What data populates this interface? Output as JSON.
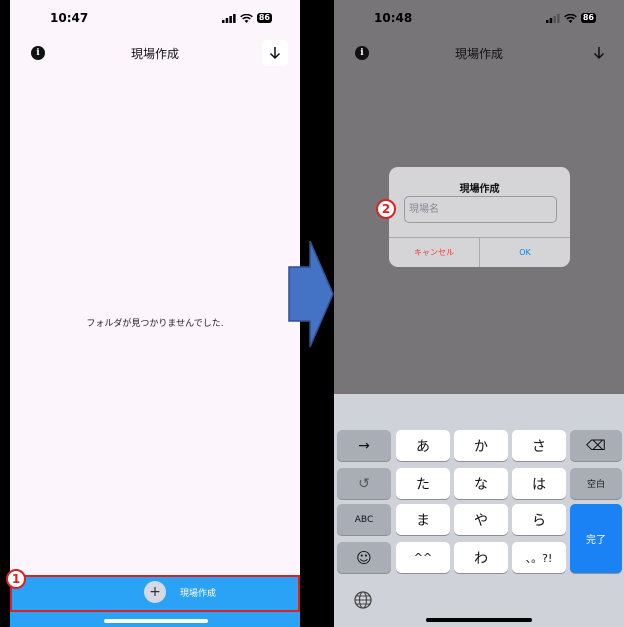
{
  "left_screen": {
    "status": {
      "time": "10:47",
      "battery": "86"
    },
    "nav": {
      "title": "現場作成"
    },
    "empty_message": "フォルダが見つかりませんでした.",
    "create_button": {
      "plus": "+",
      "label": "現場作成"
    },
    "annotation": "1"
  },
  "right_screen": {
    "status": {
      "time": "10:48",
      "battery": "86"
    },
    "nav": {
      "title": "現場作成"
    },
    "dialog": {
      "title": "現場作成",
      "input_placeholder": "現場名",
      "cancel_label": "キャンセル",
      "ok_label": "OK"
    },
    "annotation": "2",
    "keyboard": {
      "row1": [
        "→",
        "あ",
        "か",
        "さ",
        "⌫"
      ],
      "row2": [
        "↺",
        "た",
        "な",
        "は",
        "空白"
      ],
      "row3": [
        "ABC",
        "ま",
        "や",
        "ら"
      ],
      "row4": [
        "☺",
        "^^",
        "わ",
        "、。?!"
      ],
      "done_label": "完了",
      "globe": "globe-icon"
    }
  },
  "colors": {
    "accent_blue": "#2aa2f5",
    "callout_red": "#e02020",
    "arrow_blue": "#4472c4"
  }
}
